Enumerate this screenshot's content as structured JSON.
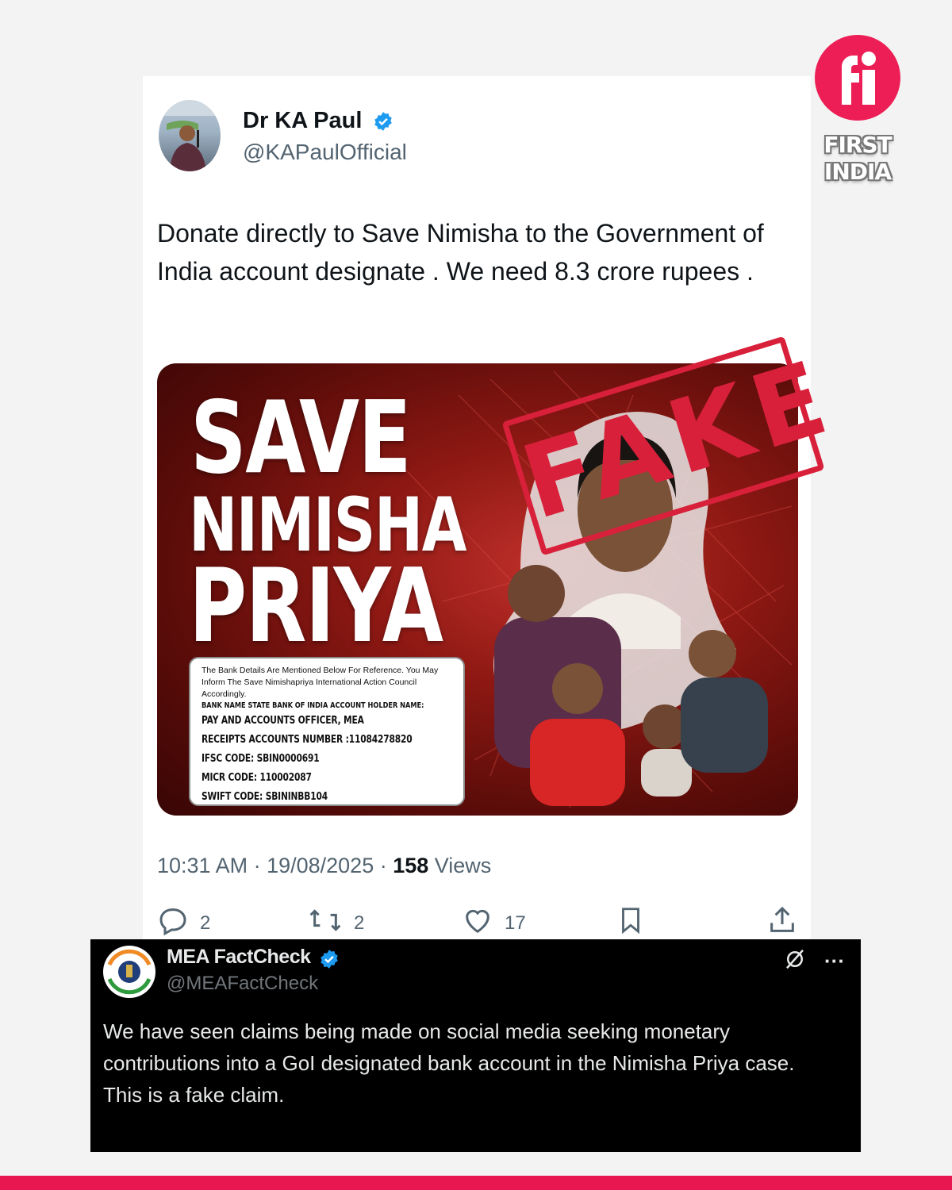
{
  "brand": {
    "line1": "FIRST",
    "line2": "INDIA",
    "accent_color": "#ec1e55",
    "logo_icon": "fi-logo-icon"
  },
  "tweet": {
    "author": {
      "name": "Dr KA Paul",
      "handle": "@KAPaulOfficial",
      "verified_icon": "verified-badge-icon"
    },
    "text": "Donate directly to Save Nimisha to the Government of India account designate . We need 8.3 crore rupees .",
    "media": {
      "title_lines": [
        "SAVE",
        "NIMISHA",
        "PRIYA"
      ],
      "stamp": "FAKE",
      "stamp_color": "#d8203a",
      "bank": {
        "intro": "The Bank Details Are Mentioned Below For Reference. You May Inform The Save Nimishapriya International Action Council Accordingly.",
        "bank_line": "BANK NAME  STATE BANK OF INDIA ACCOUNT HOLDER NAME:",
        "holder": "PAY AND ACCOUNTS OFFICER, MEA",
        "account": "RECEIPTS ACCOUNTS NUMBER :11084278820",
        "ifsc": "IFSC CODE:    SBIN0000691",
        "micr": "MICR CODE:        110002087",
        "swift": "SWIFT CODE:   SBININBB104"
      }
    },
    "timestamp": "10:31 AM · 19/08/2025 · ",
    "views_count": "158",
    "views_label": " Views",
    "actions": {
      "replies": "2",
      "retweets": "2",
      "likes": "17"
    }
  },
  "factcheck": {
    "name": "MEA FactCheck",
    "handle": "@MEAFactCheck",
    "text": "We have seen claims being made on social media seeking monetary contributions into a GoI designated bank account in the Nimisha Priya case. This is a fake claim.",
    "more_label": "···"
  }
}
